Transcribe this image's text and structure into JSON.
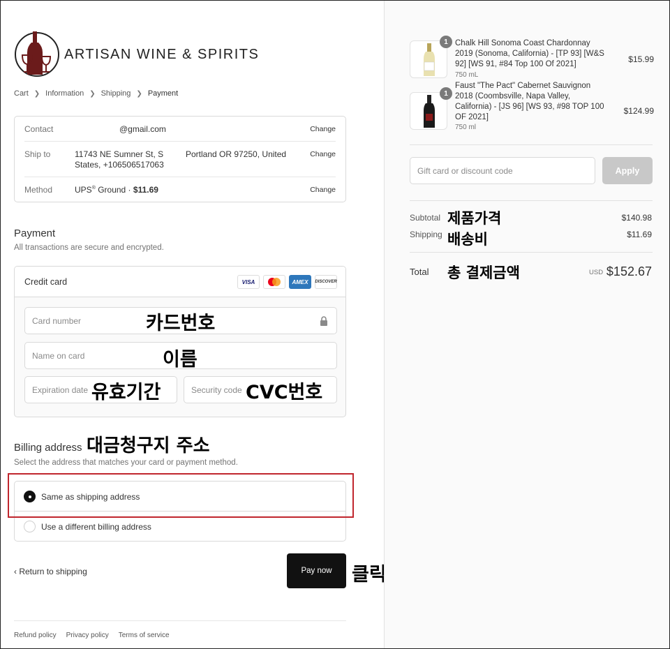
{
  "brand": {
    "name": "ARTISAN WINE & SPIRITS"
  },
  "breadcrumb": [
    "Cart",
    "Information",
    "Shipping",
    "Payment"
  ],
  "review": {
    "contact": {
      "label": "Contact",
      "value": "@gmail.com",
      "change": "Change"
    },
    "ship_to": {
      "label": "Ship to",
      "value_line1": "11743 NE Sumner St, S",
      "value_line1b": "Portland OR 97250, United",
      "value_line2": "States, +106506517063",
      "change": "Change"
    },
    "method": {
      "label": "Method",
      "value_prefix": "UPS",
      "value_reg": "®",
      "value_mid": " Ground · ",
      "value_price": "$11.69",
      "change": "Change"
    }
  },
  "payment": {
    "title": "Payment",
    "subtitle": "All transactions are secure and encrypted.",
    "credit_card_label": "Credit card",
    "brands": [
      "VISA",
      "MC",
      "AMEX",
      "DISCOVER"
    ],
    "card_number_placeholder": "Card number",
    "name_placeholder": "Name on card",
    "expiration_placeholder": "Expiration date",
    "security_placeholder": "Security code"
  },
  "billing": {
    "title": "Billing address",
    "subtitle": "Select the address that matches your card or payment method.",
    "option_same": "Same as shipping address",
    "option_different": "Use a different billing address",
    "selected": "same"
  },
  "actions": {
    "return": "Return to shipping",
    "pay": "Pay now"
  },
  "footer": [
    "Refund policy",
    "Privacy policy",
    "Terms of service"
  ],
  "annotations": {
    "card_number": "카드번호",
    "name": "이름",
    "expiration": "유효기간",
    "cvc": "CVC번호",
    "billing": "대금청구지 주소",
    "click": "클릭",
    "subtotal": "제품가격",
    "shipping": "배송비",
    "total": "총 결제금액"
  },
  "order": {
    "items": [
      {
        "qty": "1",
        "name": "Chalk Hill Sonoma Coast Chardonnay 2019 (Sonoma, California) - [TP 93] [W&S 92] [WS 91, #84 Top 100 Of 2021]",
        "variant": "750 mL",
        "price": "$15.99"
      },
      {
        "qty": "1",
        "name": "Faust \"The Pact\" Cabernet Sauvignon 2018 (Coombsville, Napa Valley, California) - [JS 96] [WS 93, #98 TOP 100 OF 2021]",
        "variant": "750 ml",
        "price": "$124.99"
      }
    ],
    "discount_placeholder": "Gift card or discount code",
    "apply": "Apply",
    "subtotal_label": "Subtotal",
    "subtotal_value": "$140.98",
    "shipping_label": "Shipping",
    "shipping_value": "$11.69",
    "total_label": "Total",
    "currency": "USD",
    "total_value": "$152.67"
  },
  "colors": {
    "highlight": "#c0262d",
    "pay_button": "#111111",
    "apply_disabled": "#c8c8c8"
  }
}
